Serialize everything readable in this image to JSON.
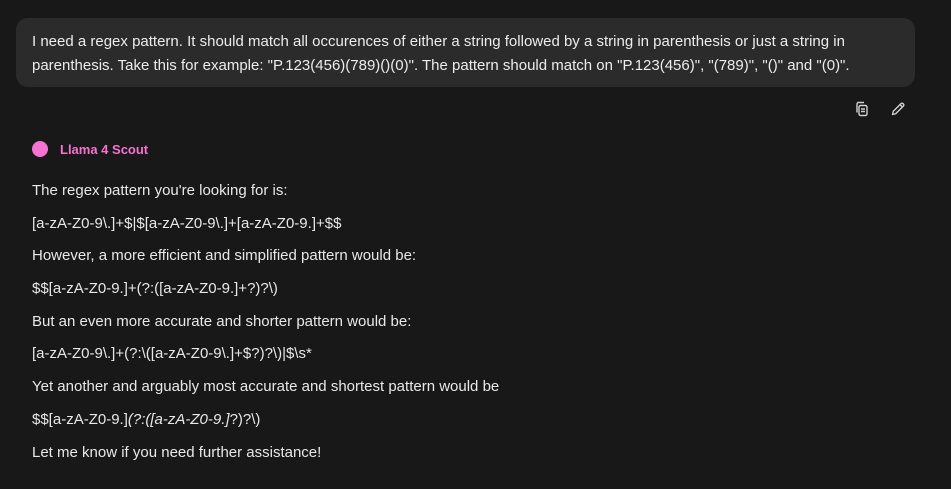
{
  "user_message": "I need a regex pattern. It should match all occurences of either a string followed by a string in parenthesis or just a string in parenthesis. Take this for example: \"P.123(456)(789)()(0)\". The pattern should match on \"P.123(456)\", \"(789)\", \"()\" and \"(0)\".",
  "actions": {
    "copy_icon": "copy-icon",
    "edit_icon": "pencil-icon"
  },
  "model": {
    "name": "Llama 4 Scout",
    "color": "#f472d0"
  },
  "answer": {
    "p1": "The regex pattern you're looking for is:",
    "p2": "[a-zA-Z0-9\\.]+$|$[a-zA-Z0-9\\.]+[a-zA-Z0-9.]+$$",
    "p3": "However, a more efficient and simplified pattern would be:",
    "p4": "$$[a-zA-Z0-9.]+(?:([a-zA-Z0-9.]+?)?\\)",
    "p5": "But an even more accurate and shorter pattern would be:",
    "p6": "[a-zA-Z0-9\\.]+(?:\\([a-zA-Z0-9\\.]+$?)?\\)|$\\s*",
    "p7": "Yet another and arguably most accurate and shortest pattern would be",
    "p8a": "$$[a-zA-Z0-9.]",
    "p8b": "(?:([a-zA-Z0-9.]",
    "p8c": "?)?\\)",
    "p9": "Let me know if you need further assistance!"
  }
}
